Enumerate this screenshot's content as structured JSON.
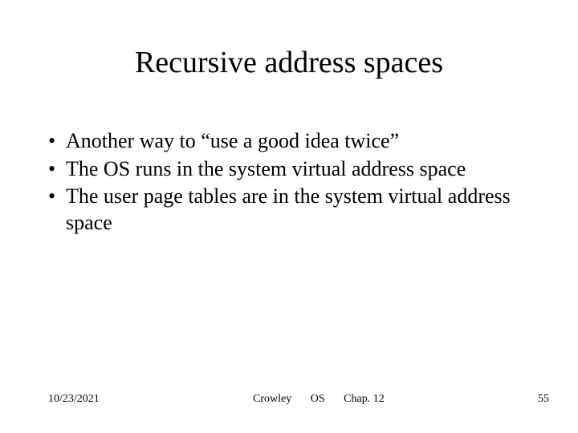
{
  "title": "Recursive address spaces",
  "bullets": [
    "Another way to “use a good idea twice”",
    "The OS runs in the system virtual address space",
    "The user page tables are in the system virtual address space"
  ],
  "footer": {
    "date": "10/23/2021",
    "author": "Crowley",
    "course": "OS",
    "chapter": "Chap. 12",
    "page": "55"
  }
}
